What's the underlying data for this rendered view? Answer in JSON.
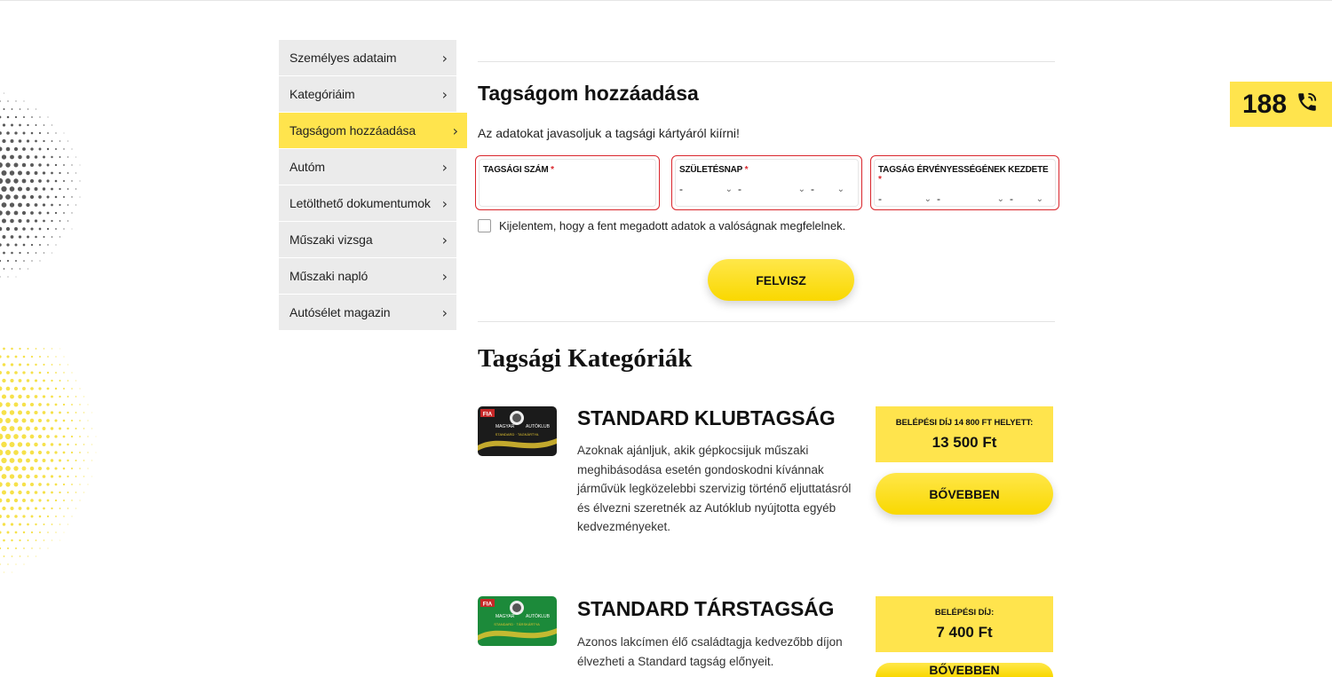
{
  "sidebar": {
    "items": [
      {
        "label": "Személyes adataim"
      },
      {
        "label": "Kategóriáim"
      },
      {
        "label": "Tagságom hozzáadása"
      },
      {
        "label": "Autóm"
      },
      {
        "label": "Letölthető dokumentumok"
      },
      {
        "label": "Műszaki vizsga"
      },
      {
        "label": "Műszaki napló"
      },
      {
        "label": "Autósélet magazin"
      }
    ],
    "active_index": 2
  },
  "form": {
    "title": "Tagságom hozzáadása",
    "hint": "Az adatokat javasoljuk a tagsági kártyáról kiírni!",
    "membership_number": {
      "label": "TAGSÁGI SZÁM",
      "required_mark": "*",
      "value": ""
    },
    "birthdate": {
      "label": "SZÜLETÉSNAP",
      "required_mark": "*",
      "year": "-",
      "month": "-",
      "day": "-"
    },
    "validity_start": {
      "label": "TAGSÁG ÉRVÉNYESSÉGÉNEK KEZDETE",
      "required_mark": "*",
      "year": "-",
      "month": "-",
      "day": "-"
    },
    "declaration": "Kijelentem, hogy a fent megadott adatok a valóságnak megfelelnek.",
    "declaration_checked": false,
    "submit_label": "FELVISZ"
  },
  "categories": {
    "title": "Tagsági Kategóriák",
    "items": [
      {
        "name": "STANDARD KLUBTAGSÁG",
        "description": "Azoknak ajánljuk, akik gépkocsijuk műszaki meghibásodása esetén gondoskodni kívánnak járművük legközelebbi szervizig történő eljuttatásról és élvezni szeretnék az Autóklub nyújtotta egyéb kedvezményeket.",
        "price_label": "BELÉPÉSI DÍJ 14 800 FT HELYETT:",
        "price": "13 500 Ft",
        "more_label": "BŐVEBBEN",
        "card_color": "#1b1b1b",
        "card_logo_text": "FIA",
        "card_line1": "MAGYAR",
        "card_line2": "AUTÓKLUB",
        "card_line3": "STANDARD · TAGKÁRTYA"
      },
      {
        "name": "STANDARD TÁRSTAGSÁG",
        "description": "Azonos lakcímen élő családtagja kedvezőbb díjon élvezheti a Standard tagság előnyeit.",
        "price_label": "BELÉPÉSI DÍJ:",
        "price": "7 400 Ft",
        "more_label": "BŐVEBBEN",
        "card_color": "#1c8a3a",
        "card_logo_text": "FIA",
        "card_line1": "MAGYAR",
        "card_line2": "AUTÓKLUB",
        "card_line3": "STANDARD · TÁRSKÁRTYA"
      }
    ]
  },
  "phone": {
    "number": "188",
    "icon": "phone-icon"
  },
  "colors": {
    "accent": "#ffe44d",
    "error": "#d9262c",
    "sidebar_bg": "#ebebeb"
  }
}
